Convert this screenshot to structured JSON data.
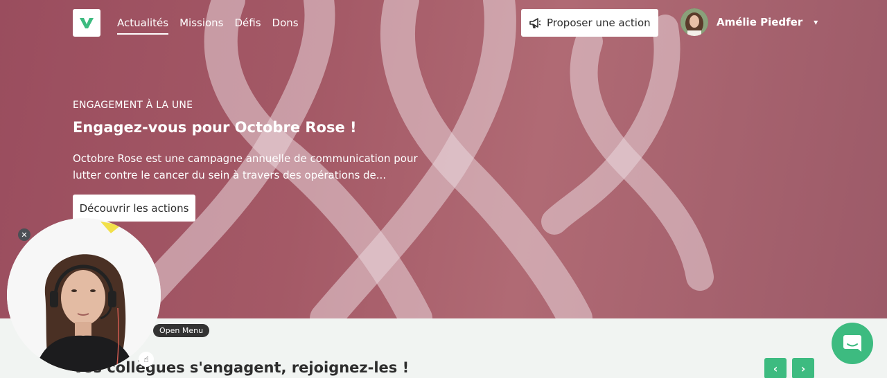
{
  "nav": {
    "items": [
      {
        "label": "Actualités",
        "active": true
      },
      {
        "label": "Missions",
        "active": false
      },
      {
        "label": "Défis",
        "active": false
      },
      {
        "label": "Dons",
        "active": false
      }
    ],
    "propose_label": "Proposer une action",
    "user_name": "Amélie Piedfer"
  },
  "hero": {
    "kicker": "ENGAGEMENT À LA UNE",
    "title": "Engagez-vous pour Octobre Rose !",
    "description": "Octobre Rose est une campagne annuelle de communication pour lutter contre le cancer du sein à travers des opérations de...",
    "cta": "Découvrir les actions"
  },
  "section": {
    "title": "Vos collègues s'engagent, rejoignez-les !"
  },
  "overlay": {
    "tooltip": "Open Menu"
  },
  "colors": {
    "accent": "#3dbb80",
    "hero_tint": "#a45966"
  }
}
